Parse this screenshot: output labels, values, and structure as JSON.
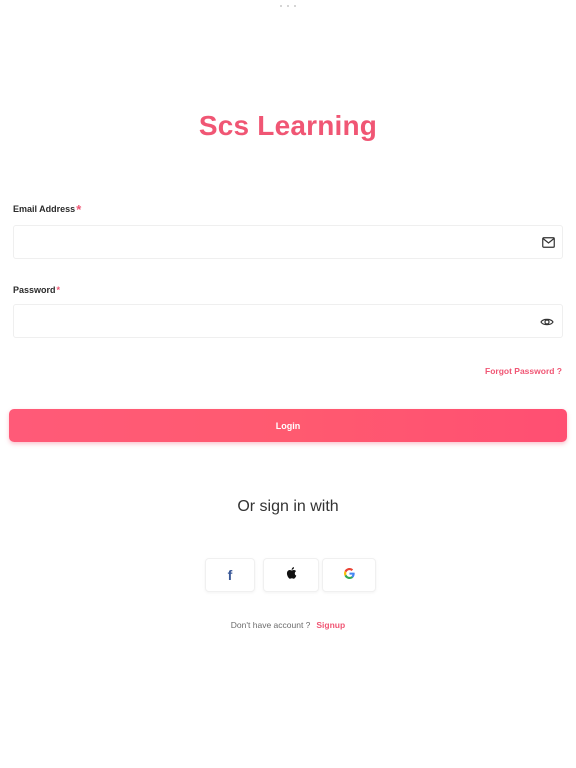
{
  "app": {
    "title": "Scs Learning"
  },
  "form": {
    "email": {
      "label": "Email Address",
      "required_mark": "*",
      "value": "",
      "placeholder": "",
      "icon": "mail-icon"
    },
    "password": {
      "label": "Password",
      "required_mark": "*",
      "value": "",
      "placeholder": "",
      "icon": "eye-icon"
    },
    "forgot_password": "Forgot Password ?",
    "login_label": "Login"
  },
  "social": {
    "heading": "Or sign in with",
    "providers": [
      {
        "name": "facebook",
        "icon": "facebook-icon",
        "glyph": "f"
      },
      {
        "name": "apple",
        "icon": "apple-icon"
      },
      {
        "name": "google",
        "icon": "google-icon"
      }
    ]
  },
  "signup": {
    "prompt": "Don't have account ?",
    "link": "Signup"
  },
  "colors": {
    "accent": "#f05674",
    "button_gradient_start": "#ff5a78",
    "button_gradient_end": "#ff4f72",
    "facebook": "#3b5998"
  }
}
